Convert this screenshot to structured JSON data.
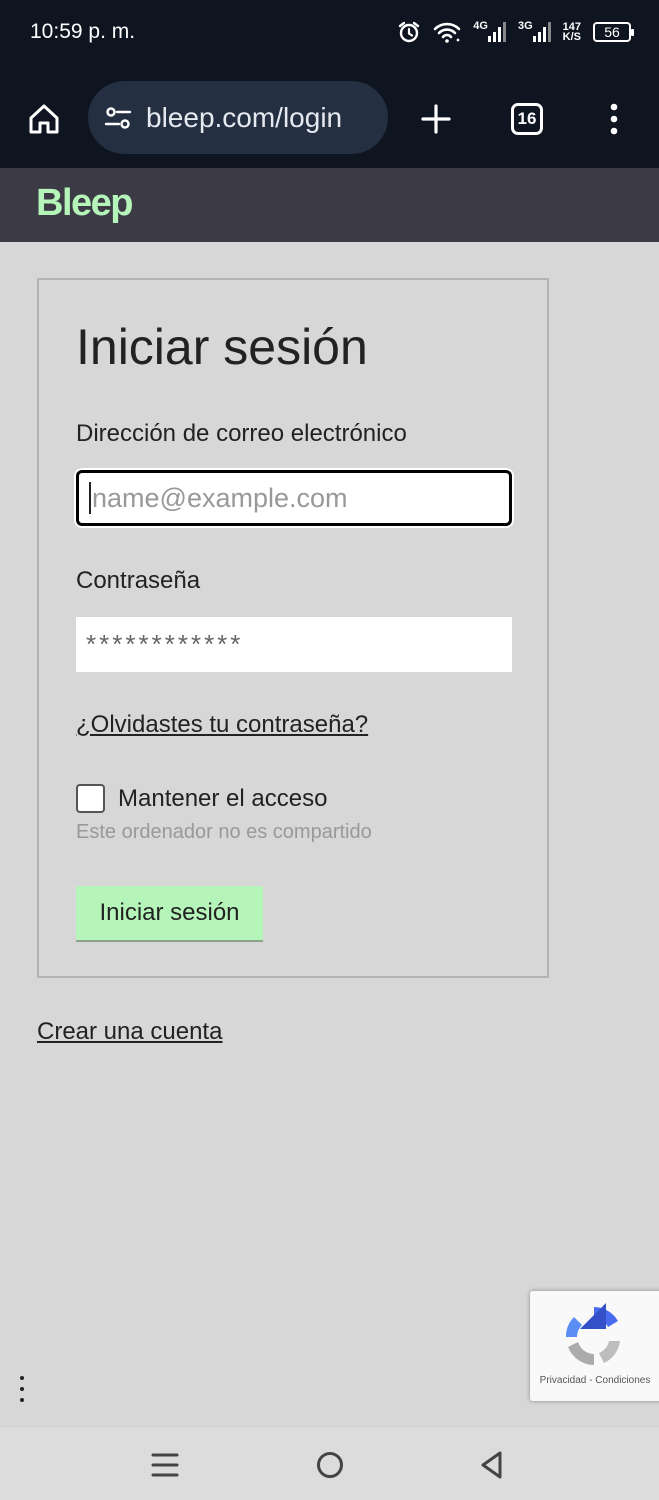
{
  "status_bar": {
    "time": "10:59 p. m.",
    "network_1": "4G",
    "network_2": "3G",
    "speed_value": "147",
    "speed_unit": "K/S",
    "battery": "56"
  },
  "browser": {
    "url": "bleep.com/login",
    "tab_count": "16"
  },
  "site": {
    "logo": "Bleep"
  },
  "login": {
    "title": "Iniciar sesión",
    "email_label": "Dirección de correo electrónico",
    "email_placeholder": "name@example.com",
    "password_label": "Contraseña",
    "password_value": "************",
    "forgot_link": "¿Olvidastes tu contraseña?",
    "remember_label": "Mantener el acceso",
    "remember_hint": "Este ordenador no es compartido",
    "submit_label": "Iniciar sesión"
  },
  "create_account_link": "Crear una cuenta",
  "recaptcha": {
    "privacy": "Privacidad",
    "separator": "-",
    "terms": "Condiciones"
  },
  "colors": {
    "brand_green": "#b6f5b9",
    "header_bg": "#3b3a45",
    "browser_bg": "#0e1420",
    "page_bg": "#d7d7d7"
  }
}
